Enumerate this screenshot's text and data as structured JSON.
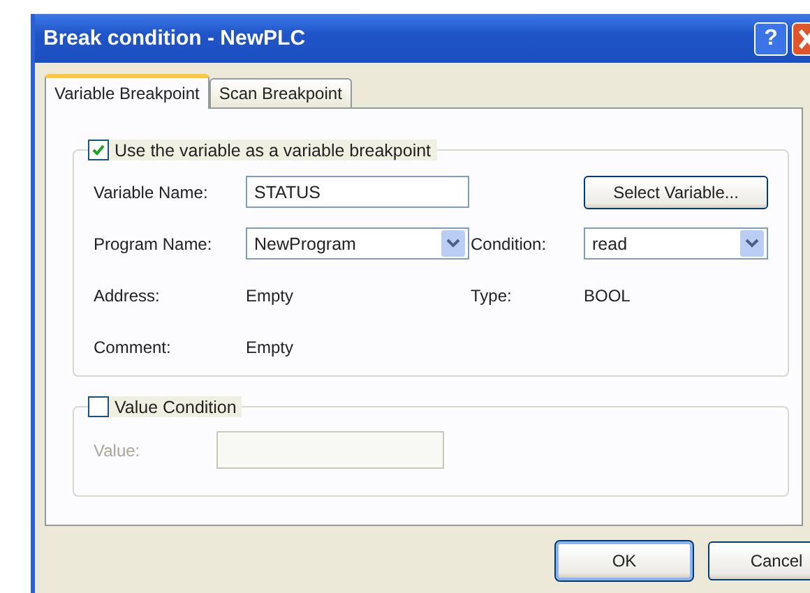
{
  "window": {
    "title": "Break condition - NewPLC",
    "help_button": "?"
  },
  "tabs": [
    {
      "label": "Variable Breakpoint",
      "selected": true
    },
    {
      "label": "Scan Breakpoint",
      "selected": false
    }
  ],
  "variable_group": {
    "label": "Use the variable as a variable breakpoint",
    "checked": true,
    "variable_name": {
      "label": "Variable Name:",
      "value": "STATUS"
    },
    "select_button": "Select Variable...",
    "program_name": {
      "label": "Program Name:",
      "value": "NewProgram"
    },
    "condition": {
      "label": "Condition:",
      "value": "read"
    },
    "address": {
      "label": "Address:",
      "value": "Empty"
    },
    "type": {
      "label": "Type:",
      "value": "BOOL"
    },
    "comment": {
      "label": "Comment:",
      "value": "Empty"
    }
  },
  "value_group": {
    "label": "Value Condition",
    "checked": false,
    "value_label": "Value:"
  },
  "buttons": [
    {
      "label": "OK",
      "default": true
    },
    {
      "label": "Cancel",
      "default": false
    }
  ]
}
